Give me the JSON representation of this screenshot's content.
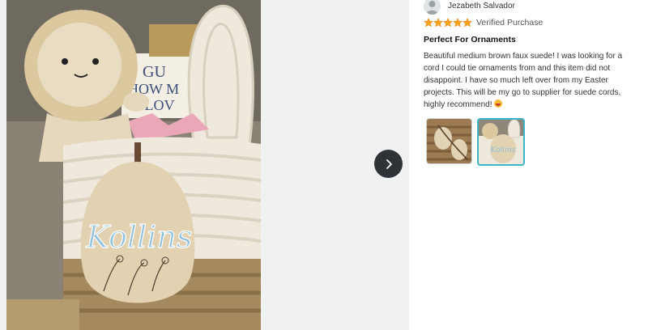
{
  "review": {
    "reviewer_name": "Jezabeth Salvador",
    "rating": 5,
    "verified": "Verified Purchase",
    "title": "Perfect For Ornaments",
    "body": "Beautiful medium brown faux suede! I was looking for a cord I could tie ornaments from and this item did not disappoint. I have so much left over from my Easter projects. This will be my go to supplier for suede cords, highly recommend!"
  },
  "photo": {
    "tag_name": "Kollins",
    "book_text": [
      "GU",
      "HOW M",
      "I LOV"
    ]
  },
  "thumbnails": [
    {
      "name": "thumbnail-1",
      "selected": false
    },
    {
      "name": "thumbnail-2",
      "selected": true,
      "tag_name": "Kollins"
    }
  ],
  "colors": {
    "star": "#ffa41c",
    "selected_border": "#3bb6c8",
    "nav_button": "#2f3338"
  },
  "icons": [
    "avatar-icon",
    "star-icon",
    "chevron-right-icon",
    "smiling-face-icon"
  ]
}
